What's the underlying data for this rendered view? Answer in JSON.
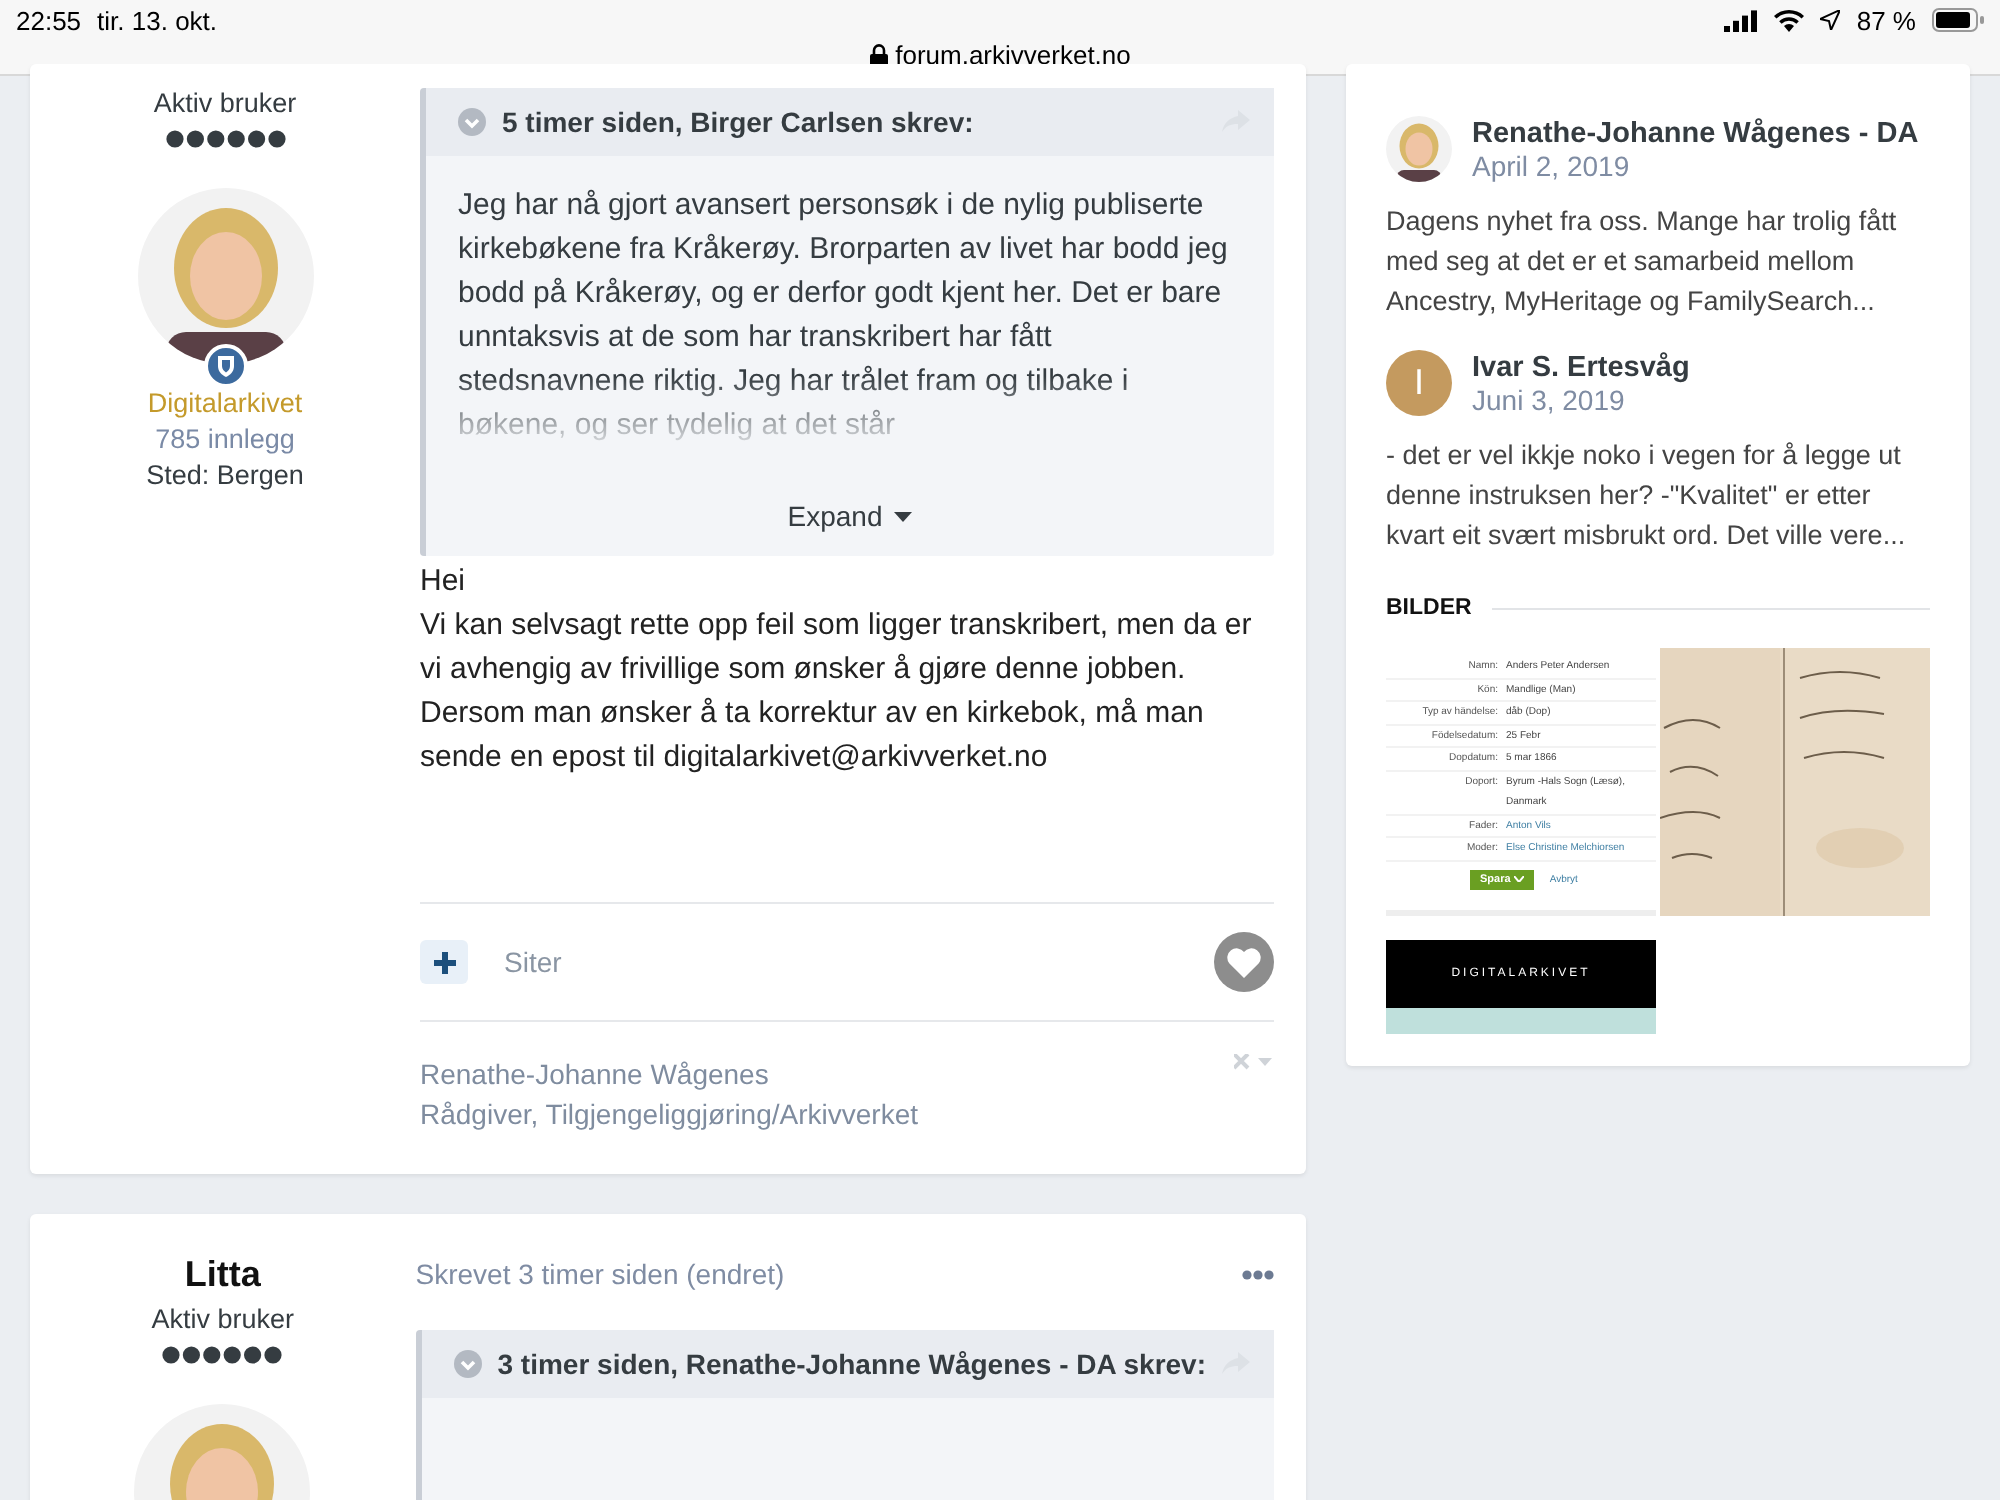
{
  "status_bar": {
    "time": "22:55",
    "date": "tir. 13. okt.",
    "battery_text": "87 %",
    "url": "forum.arkivverket.no"
  },
  "posts": [
    {
      "author": {
        "rank": "Aktiv bruker",
        "group": "Digitalarkivet",
        "post_count": "785 innlegg",
        "location": "Sted: Bergen"
      },
      "quote": {
        "header": "5 timer siden, Birger Carlsen skrev:",
        "body": "Jeg har nå gjort avansert personsøk i de nylig publiserte kirkebøkene fra Kråkerøy. Brorparten av livet har bodd jeg bodd på Kråkerøy, og er derfor godt kjent her. Det er bare unntaksvis at de som har transkribert har fått stedsnavnene riktig. Jeg har trålet fram og tilbake i bøkene, og ser tydelig at det står",
        "expand": "Expand"
      },
      "content": [
        "Hei",
        "Vi kan selvsagt rette opp feil som ligger transkribert, men da er vi avhengig av frivillige som ønsker å gjøre denne jobben. Dersom man ønsker å ta korrektur av en kirkebok, må man sende en epost til digitalarkivet@arkivverket.no"
      ],
      "quote_action": "Siter",
      "signature": [
        "Renathe-Johanne Wågenes",
        "Rådgiver, Tilgjengeliggjøring/Arkivverket"
      ]
    },
    {
      "author": {
        "name": "Litta",
        "rank": "Aktiv bruker"
      },
      "meta": "Skrevet 3 timer siden (endret)",
      "quote": {
        "header": "3 timer siden, Renathe-Johanne Wågenes - DA skrev:"
      }
    }
  ],
  "sidebar": {
    "activity": [
      {
        "name": "Renathe-Johanne Wågenes - DA",
        "date": "April 2, 2019",
        "text": "Dagens nyhet fra oss. Mange har trolig fått med seg at det er et samarbeid mellom Ancestry, MyHeritage og FamilySearch..."
      },
      {
        "name": "Ivar S. Ertesvåg",
        "date": "Juni 3, 2019",
        "kind": "letter",
        "letter": "I",
        "text": "- det er vel ikkje noko i vegen for å legge ut denne instruksen her? -\"Kvalitet\" er etter kvart eit svært misbrukt ord. Det ville vere..."
      }
    ],
    "gallery": {
      "title": "BILDER",
      "form": [
        {
          "label": "Namn:",
          "value": "Anders Peter Andersen",
          "link": false
        },
        {
          "label": "Kön:",
          "value": "Mandlige (Man)",
          "link": false
        },
        {
          "label": "Typ av händelse:",
          "value": "dåb (Dop)",
          "link": false
        },
        {
          "label": "Födelsedatum:",
          "value": "25 Febr",
          "link": false
        },
        {
          "label": "Dopdatum:",
          "value": "5 mar 1866",
          "link": false
        },
        {
          "label": "Doport:",
          "value": "Byrum -Hals Sogn (Læsø), Danmark",
          "link": false
        },
        {
          "label": "Fader:",
          "value": "Anton Vils",
          "link": true
        },
        {
          "label": "Moder:",
          "value": "Else Christine Melchiorsen",
          "link": true
        }
      ],
      "save": "Spara",
      "cancel": "Avbryt",
      "banner": "DIGITALARKIVET"
    }
  }
}
